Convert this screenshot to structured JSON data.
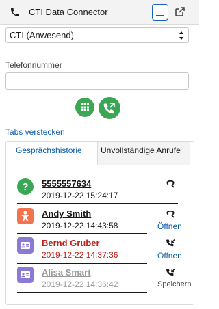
{
  "header": {
    "title": "CTI Data Connector",
    "phone_icon": "phone-icon",
    "minimize_icon": "minimize-icon",
    "popout_icon": "popout-icon"
  },
  "status": {
    "selected": "CTI (Anwesend)"
  },
  "phone": {
    "label": "Telefonnummer",
    "value": "",
    "placeholder": ""
  },
  "hide_tabs": "Tabs verstecken",
  "tabs": [
    {
      "label": "Gesprächshistorie",
      "active": true
    },
    {
      "label": "Unvollständige Anrufe",
      "active": false
    }
  ],
  "history": [
    {
      "name": "5555557634",
      "time": "2019-12-22 15:24:17",
      "icon": "question-icon",
      "action": "",
      "direction": "outgoing"
    },
    {
      "name": "Andy Smith",
      "time": "2019-12-22 14:43:58",
      "icon": "person-icon",
      "action": "Öffnen",
      "direction": "outgoing"
    },
    {
      "name": "Bernd Gruber",
      "time": "2019-12-22 14:37:36",
      "icon": "contact-card-icon",
      "action": "Öffnen",
      "direction": "incoming"
    },
    {
      "name": "Alisa Smart",
      "time": "2019-12-22 14:36:42",
      "icon": "contact-card-icon",
      "action": "Speichern",
      "direction": "incoming"
    }
  ],
  "colors": {
    "accent": "#0b5cab",
    "green": "#3ba755",
    "orange": "#f4734f",
    "purple": "#8a7ad3",
    "gray": "#9a9a9a",
    "red": "#b9231c"
  }
}
